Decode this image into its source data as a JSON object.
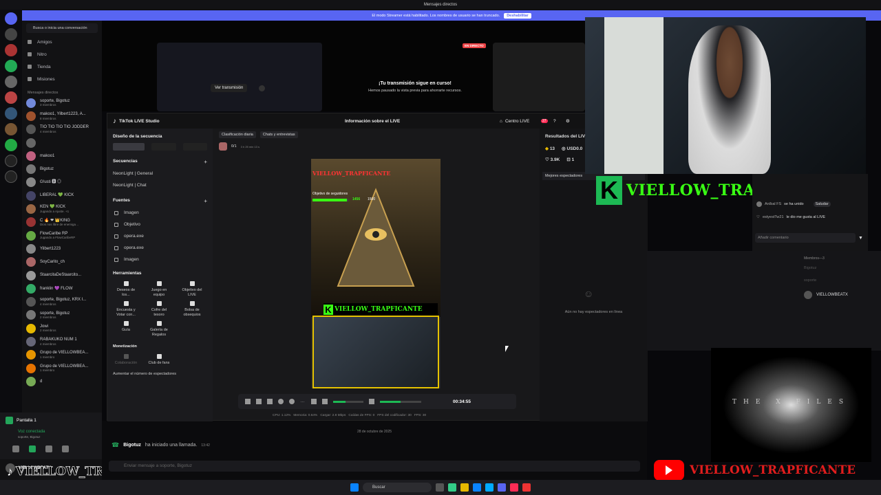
{
  "window": {
    "title": "Mensajes directos"
  },
  "banner": {
    "text": "El modo Streamer está habilitado. Los nombres de usuario se han truncado.",
    "button": "Deshabilitar"
  },
  "dm": {
    "search": "Busca o inicia una conversación",
    "nav": [
      "Amigos",
      "Nitro",
      "Tienda",
      "Misiones"
    ],
    "section": "Mensajes directos",
    "list": [
      {
        "name": "soporte, Bigotuz",
        "sub": "3 miembros",
        "color": "#7289da"
      },
      {
        "name": "makoo1, Yilbert1223, A...",
        "sub": "8 miembros",
        "color": "#a0522d"
      },
      {
        "name": "TIO TIO TIO TIO JODDER",
        "sub": "4 miembros",
        "color": "#555"
      },
      {
        "name": "",
        "sub": "",
        "color": "#666"
      },
      {
        "name": "makoo1",
        "sub": "",
        "color": "#c06080"
      },
      {
        "name": "Bigotuz",
        "sub": "",
        "color": "#777"
      },
      {
        "name": "G!usti 🅱 ◎",
        "sub": "",
        "color": "#888"
      },
      {
        "name": "LIBERAL 💚 KICK",
        "sub": "",
        "color": "#446"
      },
      {
        "name": "KEN 💚 KICK",
        "sub": "Jugando a Ajuste. +1",
        "color": "#964"
      },
      {
        "name": "C 🔥 ❤ 👑KING",
        "sub": "Dios nos libre de enemiga…",
        "color": "#933"
      },
      {
        "name": "FlowCaribe RP",
        "sub": "Jugando a FlowCaribeRP",
        "color": "#6a4"
      },
      {
        "name": "Yilbert1223",
        "sub": "",
        "color": "#888"
      },
      {
        "name": "SoyCarito_ch",
        "sub": "",
        "color": "#a66"
      },
      {
        "name": "StaarcitaDeStaarcito...",
        "sub": "",
        "color": "#999"
      },
      {
        "name": "franklin 💜 FLOW",
        "sub": "",
        "color": "#3a6"
      },
      {
        "name": "soporte, Bigotuz, KRX I...",
        "sub": "4 miembros",
        "color": "#555"
      },
      {
        "name": "soporte, Bigotuz",
        "sub": "2 miembros",
        "color": "#777"
      },
      {
        "name": "Jowi",
        "sub": "2 miembros",
        "color": "#e6b800"
      },
      {
        "name": "RABAKUKO NUM 1",
        "sub": "4 miembros",
        "color": "#667"
      },
      {
        "name": "Grupo de VIELLOWBEA...",
        "sub": "1 miembro",
        "color": "#e69500"
      },
      {
        "name": "Grupo de VIELLOWBEA...",
        "sub": "1 miembro",
        "color": "#e67300"
      },
      {
        "name": "d",
        "sub": "",
        "color": "#7a5"
      }
    ]
  },
  "call": {
    "screen": "Pantalla 1",
    "status": "Voz conectada",
    "channel": "soporte, Bigotuz"
  },
  "user": {
    "name": "VIELLOWBEATX"
  },
  "stream": {
    "view": "Ver transmisión",
    "live_badge": "EN DIRECTO",
    "msg1": "¡Tu transmisión sigue en curso!",
    "msg2": "Hemos pausado la vista previa para ahorrarte recursos."
  },
  "tiktok": {
    "app": "TikTok LIVE Studio",
    "header_center": "Información sobre el LIVE",
    "center_btn": "Centro LIVE",
    "notif": "27",
    "design": "Diseño de la secuencia",
    "sequences_title": "Secuencias",
    "sequences": [
      "NeonLight | General",
      "NeonLight | Chat"
    ],
    "sources_title": "Fuentes",
    "sources": [
      "Imagen",
      "Objetivo",
      "opera.exe",
      "opera.exe",
      "Imagen"
    ],
    "tools_title": "Herramientas",
    "tools": [
      "Deseos de los...",
      "Juego en equipo",
      "Objetivo del LIVE",
      "Encuesta y Votar con...",
      "Cofre del tesoro",
      "Bolsa de obsequios",
      "Guía",
      "Galería de Regalos"
    ],
    "monet_title": "Monetización",
    "monet": [
      "Colaboración",
      "Club de fans"
    ],
    "boost": "Aumentar el número de espectadores",
    "tab1": "Clasificación diaria",
    "tab2": "Chats y entrevistas",
    "ranking": "0/1",
    "ranking_time": "3 h 25 min 13 s",
    "goal_label": "Objetivo de seguidores",
    "goal_current": "1456",
    "goal_target": "1500",
    "goal_progress": 0.97,
    "preview_name": "VIELLOW_TRAPFICANTE",
    "timer": "00:34:55",
    "stats": "CPU: 1.12%   Memoria: 0.64%   Cargar: 2.8 Mbps   Caídas de FPS: 0   FPS del codificador: 30   FPS: 30",
    "results_title": "Resultados del LIVE",
    "r_gift": "13",
    "r_usd": "USD0.0",
    "r_likes": "3.9K",
    "r_shares": "1",
    "best_viewers": "Mejores espectadores",
    "no_viewers": "Aún no hay espectadores en línea"
  },
  "overlay": {
    "name": "VIELLOW_TRAPFICANTE",
    "k": "K"
  },
  "chat": {
    "msgs": [
      {
        "user": "Aníbal FS",
        "text": "se ha unido",
        "action": "Saludar"
      },
      {
        "user": "estyestTw21",
        "text": "le dio me gusta al LIVE"
      }
    ],
    "input": "Añadir comentario"
  },
  "members": {
    "header": "Miembros—3",
    "list": [
      "Bigotuz",
      "soporte",
      "VIELLOWBEATX"
    ]
  },
  "discord_chat": {
    "date": "28 de octubre de 2025",
    "call_user": "Bigotuz",
    "call_text": "ha iniciado una llamada.",
    "call_time": "13:42",
    "input": "Enviar mensaje a soporte, Bigotuz"
  },
  "xfiles": {
    "text": "THE X FILES"
  },
  "youtube": {
    "name": "VIELLOW_TRAPFICANTE"
  },
  "tiktok_brand": {
    "name": "VIELLOW_TRAPFICANTE"
  },
  "taskbar": {
    "search": "Buscar"
  }
}
